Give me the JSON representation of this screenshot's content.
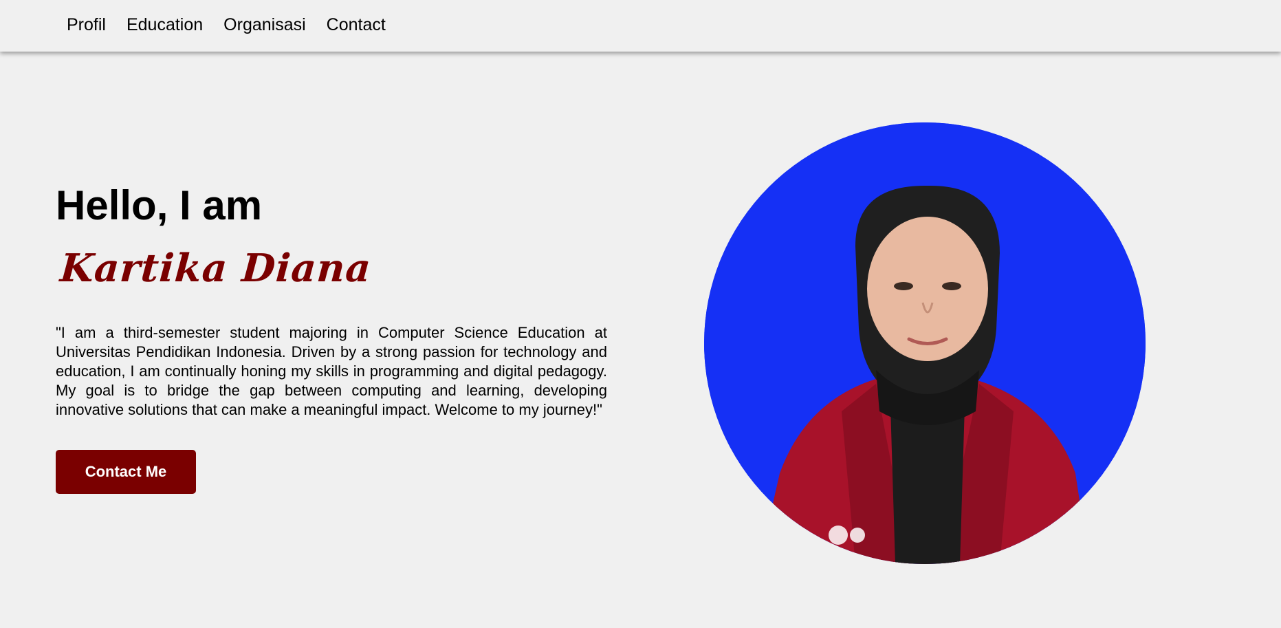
{
  "nav": {
    "items": [
      {
        "label": "Profil"
      },
      {
        "label": "Education"
      },
      {
        "label": "Organisasi"
      },
      {
        "label": "Contact"
      }
    ]
  },
  "hero": {
    "greeting": "Hello, I am",
    "name": "Kartika Diana",
    "bio": "\"I am a third-semester student majoring in Computer Science Education at Universitas Pendidikan Indonesia. Driven by a strong passion for technology and education, I am continually honing my skills in programming and digital pedagogy. My goal is to bridge the gap between computing and learning, developing innovative solutions that can make a meaningful impact. Welcome to my journey!\"",
    "button_label": "Contact Me"
  },
  "colors": {
    "accent": "#7a0000",
    "background": "#f0f0f0",
    "portrait_background": "#1530f5"
  }
}
